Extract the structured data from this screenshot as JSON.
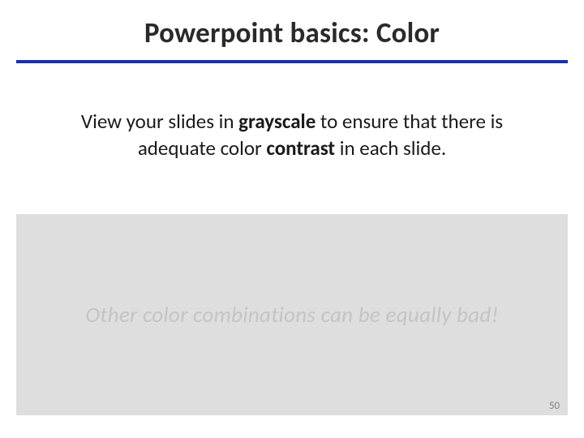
{
  "title": "Powerpoint basics: Color",
  "body": {
    "prefix": "View your slides in ",
    "bold1": "grayscale",
    "mid": " to ensure that there is adequate color ",
    "bold2": "contrast",
    "suffix": " in each slide."
  },
  "example_text": "Other color combinations can be equally bad!",
  "page_number": "50",
  "colors": {
    "underline": "#1a2fb3",
    "example_bg": "#dedede",
    "example_fg": "#c4c4c4"
  }
}
